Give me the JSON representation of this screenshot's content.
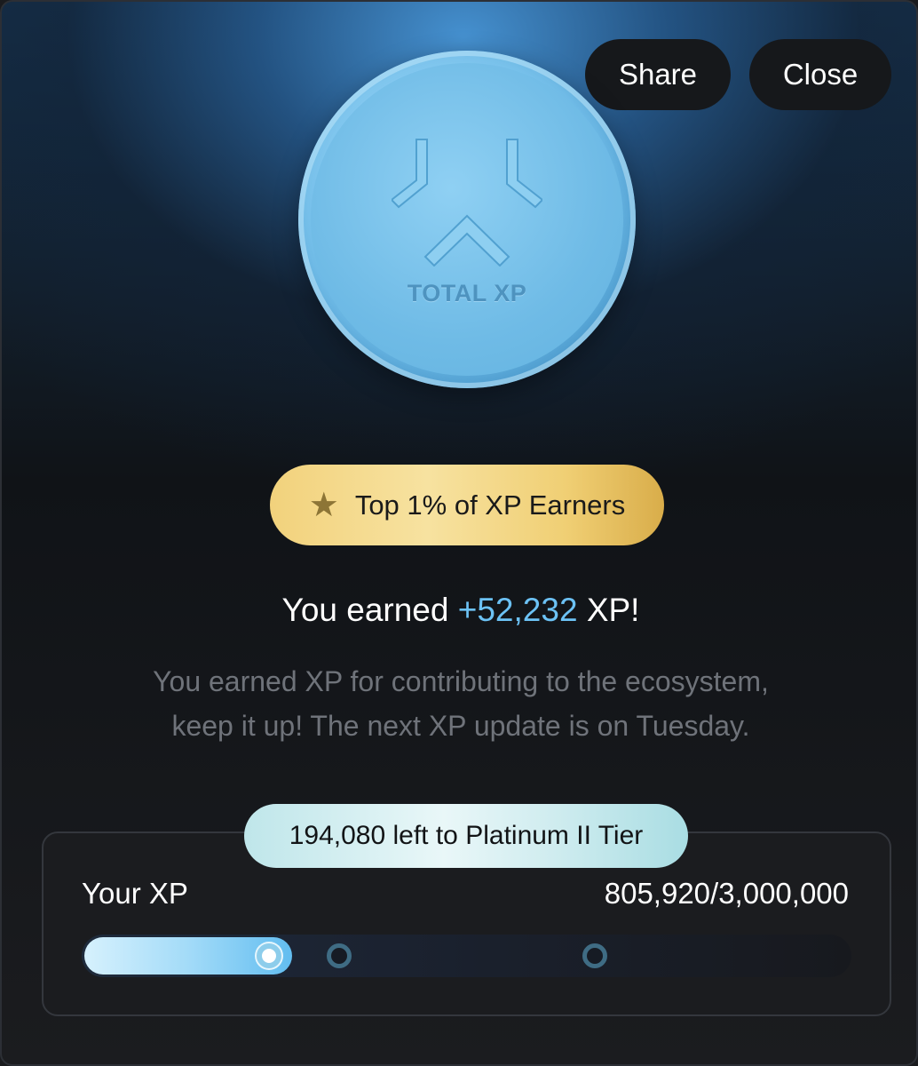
{
  "header": {
    "share_label": "Share",
    "close_label": "Close"
  },
  "coin": {
    "label": "TOTAL XP",
    "icon": "total-xp-logo"
  },
  "badge": {
    "icon": "star-icon",
    "label": "Top 1% of XP Earners"
  },
  "earned": {
    "prefix": "You earned",
    "amount": "+52,232",
    "suffix": "XP!"
  },
  "description": {
    "line1": "You earned XP for contributing to the ecosystem,",
    "line2": "keep it up! The next XP update is on Tuesday."
  },
  "xp_card": {
    "tier_label": "194,080 left to Platinum II Tier",
    "your_xp_label": "Your XP",
    "value_label": "805,920/3,000,000",
    "progress_fraction": 0.27
  },
  "colors": {
    "accent": "#6cc2f5",
    "badge_gold": "#f2d27c",
    "background": "#1b1c1f"
  }
}
